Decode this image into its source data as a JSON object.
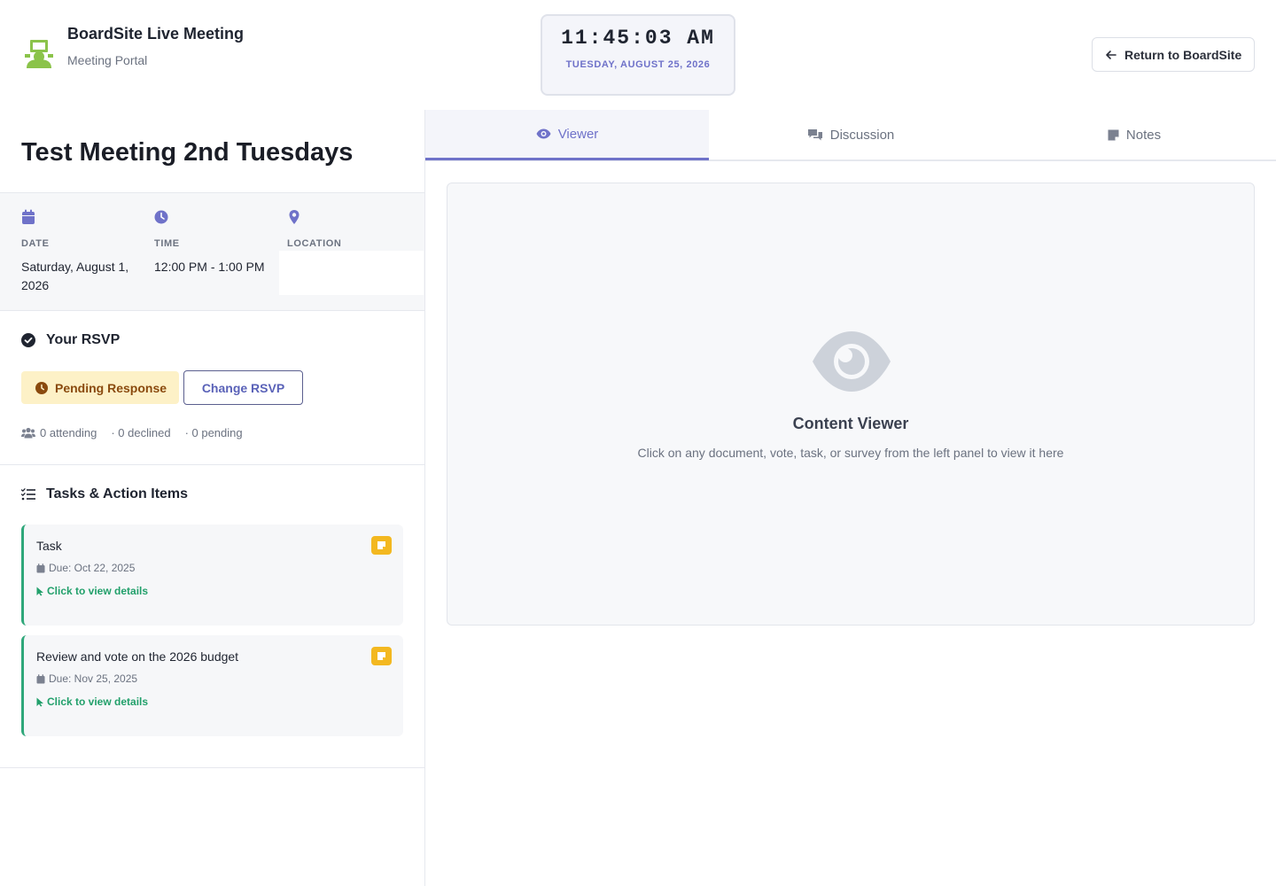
{
  "header": {
    "app_title": "BoardSite Live Meeting",
    "app_subtitle": "Meeting Portal",
    "clock_time": "11:45:03 AM",
    "clock_date": "TUESDAY, AUGUST 25, 2026",
    "return_label": "Return to BoardSite"
  },
  "meeting": {
    "title": "Test Meeting 2nd Tuesdays",
    "date_label": "DATE",
    "date_value": "Saturday, August 1, 2026",
    "time_label": "TIME",
    "time_value": "12:00 PM - 1:00 PM",
    "location_label": "LOCATION",
    "location_value": ""
  },
  "rsvp": {
    "title": "Your RSVP",
    "status": "Pending Response",
    "change_label": "Change RSVP",
    "attending": "0 attending",
    "declined": "· 0 declined",
    "pending": "· 0 pending"
  },
  "tasks": {
    "title": "Tasks & Action Items",
    "items": [
      {
        "title": "Task",
        "due": "Due: Oct 22, 2025",
        "link": "Click to view details"
      },
      {
        "title": "Review and vote on the 2026 budget",
        "due": "Due: Nov 25, 2025",
        "link": "Click to view details"
      }
    ]
  },
  "tabs": [
    {
      "label": "Viewer",
      "icon": "eye-icon",
      "active": true
    },
    {
      "label": "Discussion",
      "icon": "comments-icon",
      "active": false
    },
    {
      "label": "Notes",
      "icon": "note-icon",
      "active": false
    }
  ],
  "viewer": {
    "title": "Content Viewer",
    "description": "Click on any document, vote, task, or survey from the left panel to view it here"
  },
  "colors": {
    "accent": "#6f72c9",
    "task_border": "#2fa77a",
    "pending_bg": "#fdf1c7",
    "tag": "#f3b820"
  }
}
